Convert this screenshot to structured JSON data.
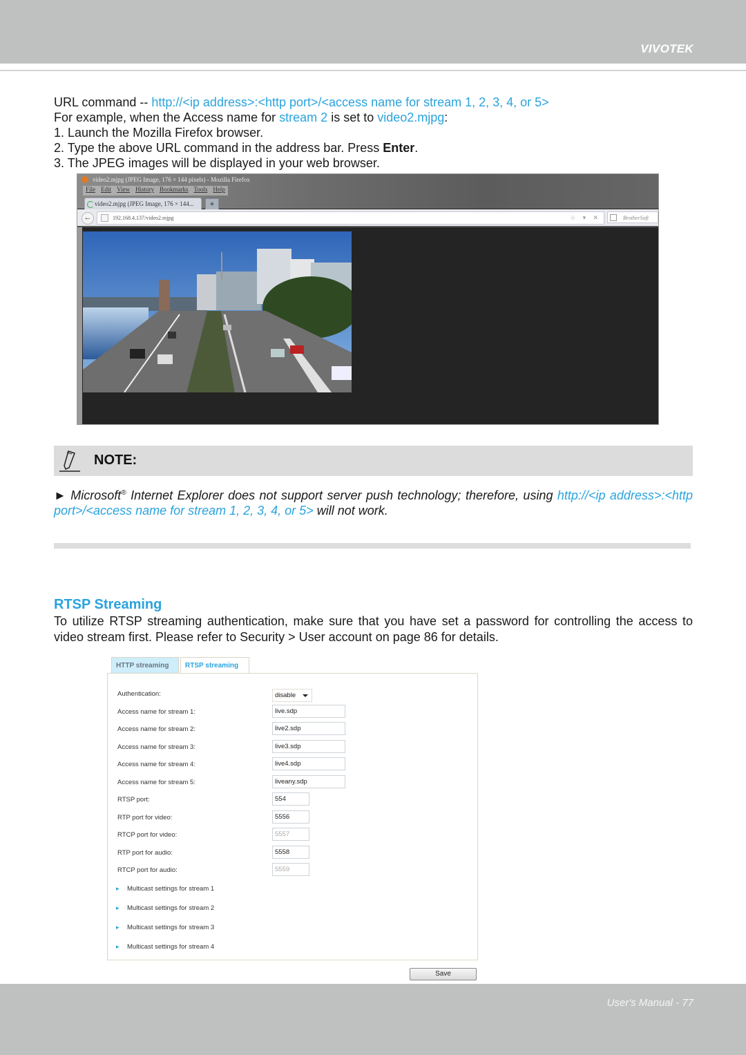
{
  "header": {
    "brand": "VIVOTEK"
  },
  "intro": {
    "url_prefix": "URL command -- ",
    "url_command": "http://<ip address>:<http port>/<access name for stream 1, 2, 3, 4, or 5>",
    "example_prefix": "For example, when the Access name for ",
    "example_stream": "stream 2",
    "example_mid": " is set to ",
    "example_value": "video2.mjpg",
    "example_suffix": ":",
    "steps": [
      {
        "text": "1. Launch the Mozilla Firefox browser."
      },
      {
        "text_before": "2. Type the above URL command in the address bar. Press ",
        "bold": "Enter",
        "text_after": "."
      },
      {
        "text": "3. The JPEG images will be displayed in your web browser."
      }
    ]
  },
  "browser_screenshot": {
    "window_title": "video2.mjpg (JPEG Image, 176 × 144 pixels) - Mozilla Firefox",
    "menu": [
      "File",
      "Edit",
      "View",
      "History",
      "Bookmarks",
      "Tools",
      "Help"
    ],
    "tab_label": "video2.mjpg (JPEG Image, 176 × 144...",
    "new_tab": "+",
    "address": "192.168.4.137/video2.mjpg",
    "address_controls": "☆ ▾ ✕",
    "search_placeholder": "BrotherSoft",
    "back": "←"
  },
  "note": {
    "title": "NOTE:",
    "bullet": "►",
    "text_start": "Microsoft",
    "registered": "®",
    "text_mid": " Internet Explorer does not support server push technology; therefore, using ",
    "link": "http://<ip address>:<http port>/<access name for stream 1, 2, 3, 4, or 5>",
    "text_end": " will not work."
  },
  "rtsp": {
    "title": "RTSP Streaming",
    "paragraph": "To utilize RTSP streaming authentication, make sure that you have set a password for controlling the access to video stream first. Please refer to Security > User account on page 86 for details.",
    "tabs": [
      {
        "label": "HTTP streaming",
        "active": false
      },
      {
        "label": "RTSP streaming",
        "active": true
      }
    ],
    "authentication": {
      "label": "Authentication:",
      "value": "disable"
    },
    "fields": [
      {
        "label": "Access name for stream 1:",
        "value": "live.sdp",
        "disabled": false
      },
      {
        "label": "Access name for stream 2:",
        "value": "live2.sdp",
        "disabled": false
      },
      {
        "label": "Access name for stream 3:",
        "value": "live3.sdp",
        "disabled": false
      },
      {
        "label": "Access name for stream 4:",
        "value": "live4.sdp",
        "disabled": false
      },
      {
        "label": "Access name for stream 5:",
        "value": "liveany.sdp",
        "disabled": false
      },
      {
        "label": "RTSP port:",
        "value": "554",
        "disabled": false
      },
      {
        "label": "RTP port for video:",
        "value": "5556",
        "disabled": false
      },
      {
        "label": "RTCP port for video:",
        "value": "5557",
        "disabled": true
      },
      {
        "label": "RTP port for audio:",
        "value": "5558",
        "disabled": false
      },
      {
        "label": "RTCP port for audio:",
        "value": "5559",
        "disabled": true
      }
    ],
    "multicast": [
      "Multicast settings for stream 1",
      "Multicast settings for stream 2",
      "Multicast settings for stream 3",
      "Multicast settings for stream 4"
    ],
    "save_label": "Save"
  },
  "footer": {
    "text": "User's Manual - 77"
  },
  "colors": {
    "accent": "#2aa3dd",
    "header_bg": "#bfc1c0",
    "note_bg": "#dcdcdc"
  }
}
